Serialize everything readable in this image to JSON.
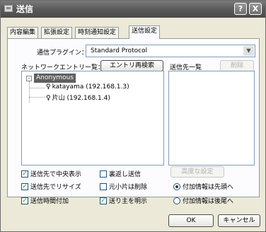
{
  "window": {
    "title": "送信",
    "help_label": "?",
    "close_label": "X"
  },
  "tabs": [
    {
      "label": "内容編集"
    },
    {
      "label": "拡張設定"
    },
    {
      "label": "時刻通知設定"
    },
    {
      "label": "送信設定"
    }
  ],
  "protocol": {
    "label": "通信プラグイン：",
    "value": "Standard Protocol"
  },
  "network": {
    "label": "ネットワークエントリー覧：",
    "rescan_button": "エントリ再検索",
    "tree": {
      "expander": "-",
      "root": "Anonymous",
      "items": [
        {
          "icon": "person-icon",
          "label": "katayama (192.168.1.3)"
        },
        {
          "icon": "person-icon",
          "label": "片山 (192.168.1.4)"
        }
      ]
    }
  },
  "destinations": {
    "label": "送信先一覧",
    "delete_button": "削除"
  },
  "options": {
    "center_display": {
      "label": "送信先で中央表示",
      "checked": true
    },
    "resize": {
      "label": "送信先でリサイズ",
      "checked": true
    },
    "add_send_time": {
      "label": "送信時間付加",
      "checked": true
    },
    "reply_send": {
      "label": "裏返し送信",
      "checked": false
    },
    "delete_original": {
      "label": "元小片は削除",
      "checked": false
    },
    "show_sender": {
      "label": "送り主を明示",
      "checked": true
    },
    "advanced_button": "高度な設定",
    "info_head": {
      "label": "付加情報は先頭へ",
      "selected": true
    },
    "info_tail": {
      "label": "付加情報は後尾へ",
      "selected": false
    }
  },
  "footer": {
    "ok_label": "OK",
    "cancel_label": "キャンセル"
  }
}
